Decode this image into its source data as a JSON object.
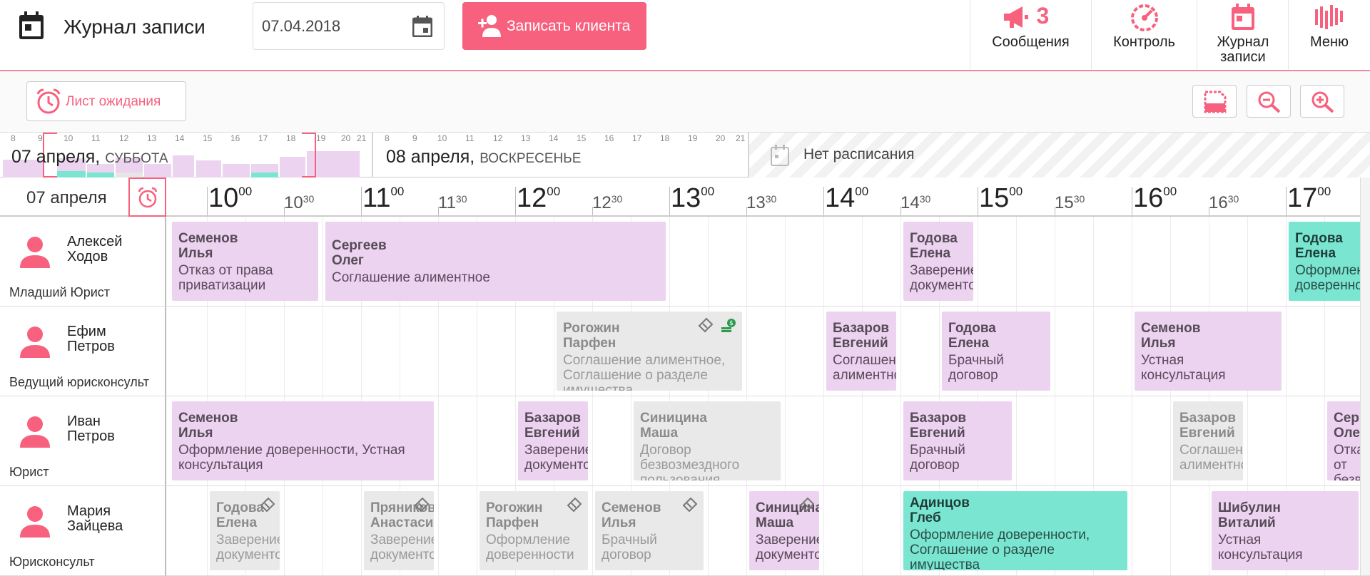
{
  "header": {
    "title": "Журнал записи",
    "date_value": "07.04.2018",
    "add_client_label": "Записать клиента",
    "nav": [
      {
        "label": "Сообщения",
        "badge": "3"
      },
      {
        "label": "Контроль"
      },
      {
        "label": "Журнал записи"
      },
      {
        "label": "Меню"
      }
    ]
  },
  "toolbar": {
    "waitlist_label": "Лист ожидания"
  },
  "days": {
    "day1_date": "07 апреля,",
    "day1_weekday": "СУББОТА",
    "day2_date": "08 апреля,",
    "day2_weekday": "ВОСКРЕСЕНЬЕ",
    "day1_hours": [
      "8",
      "9",
      "10",
      "11",
      "12",
      "13",
      "14",
      "15",
      "16",
      "17",
      "18",
      "19",
      "20",
      "21"
    ],
    "day2_hours": [
      "8",
      "9",
      "10",
      "11",
      "12",
      "13",
      "14",
      "15",
      "16",
      "17",
      "18",
      "19",
      "20",
      "21"
    ],
    "no_schedule": "Нет расписания"
  },
  "grid": {
    "corner_label": "07 апреля",
    "hours": [
      "10",
      "11",
      "12",
      "13",
      "14",
      "15",
      "16",
      "17"
    ],
    "minutes_00": "00",
    "minutes_30": "30"
  },
  "employees": [
    {
      "first": "Алексей",
      "last": "Ходов",
      "role": "Младший Юрист"
    },
    {
      "first": "Ефим",
      "last": "Петров",
      "role": "Ведущий юрисконсульт"
    },
    {
      "first": "Иван",
      "last": "Петров",
      "role": "Юрист"
    },
    {
      "first": "Мария",
      "last": "Зайцева",
      "role": "Юрисконсульт"
    }
  ],
  "appointments": {
    "r0": [
      {
        "client": "Семенов\nИлья",
        "service": "Отказ от права\nприватизации"
      },
      {
        "client": "Сергеев\nОлег",
        "service": "Соглашение алиментное"
      },
      {
        "client": "Годова\nЕлена",
        "service": "Заверение\nдокументов"
      },
      {
        "client": "Годова\nЕлена",
        "service": "Оформление\nдоверенности"
      }
    ],
    "r1": [
      {
        "client": "Рогожин\nПарфен",
        "service": "Соглашение алиментное,\nСоглашение о разделе\nимущества"
      },
      {
        "client": "Базаров\nЕвгений",
        "service": "Соглашение\nалиментное"
      },
      {
        "client": "Годова\nЕлена",
        "service": "Брачный\nдоговор"
      },
      {
        "client": "Семенов\nИлья",
        "service": "Устная\nконсультация"
      }
    ],
    "r2": [
      {
        "client": "Семенов\nИлья",
        "service": "Оформление доверенности, Устная\nконсультация"
      },
      {
        "client": "Базаров\nЕвгений",
        "service": "Заверение\nдокументов"
      },
      {
        "client": "Синицина\nМаша",
        "service": "Договор\nбезвозмездного\nпользования"
      },
      {
        "client": "Базаров\nЕвгений",
        "service": "Брачный\nдоговор"
      },
      {
        "client": "Базаров\nЕвгений",
        "service": "Соглашение\nалиментное"
      },
      {
        "client": "Сергеев\nОлег",
        "service": "Отказ от\nбезвозмездного"
      }
    ],
    "r3": [
      {
        "client": "Годова\nЕлена",
        "service": "Заверение\nдокументов"
      },
      {
        "client": "Пряникова\nАнастасия",
        "service": "Заверение\nдокументов"
      },
      {
        "client": "Рогожин\nПарфен",
        "service": "Оформление\nдоверенности"
      },
      {
        "client": "Семенов\nИлья",
        "service": "Брачный\nдоговор"
      },
      {
        "client": "Синицина\nМаша",
        "service": "Заверение\nдокументов"
      },
      {
        "client": "Адинцов\nГлеб",
        "service": "Оформление доверенности,\nСоглашение о разделе\nимущества"
      },
      {
        "client": "Шибулин\nВиталий",
        "service": "Устная\nконсультация"
      }
    ]
  },
  "colors": {
    "accent": "#f7617e",
    "appt_pink": "#ecd3ef",
    "appt_grey": "#e9e9e9",
    "appt_teal": "#7ae6d2"
  }
}
